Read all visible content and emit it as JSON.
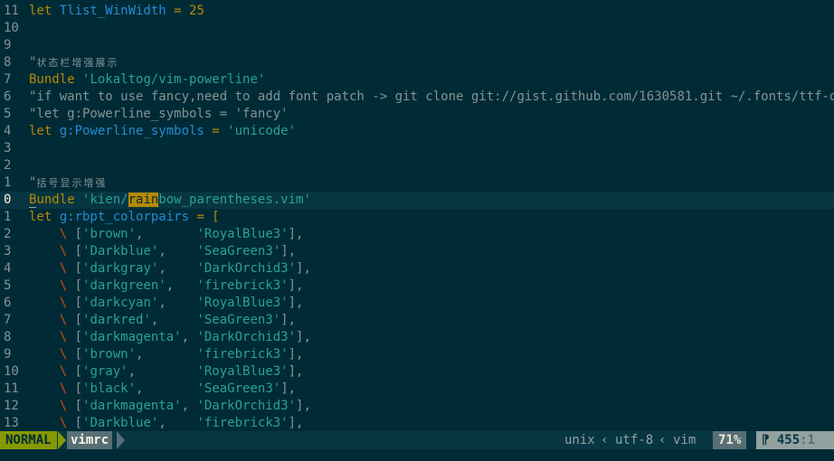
{
  "editor": {
    "lines": [
      {
        "n": "11",
        "segs": [
          {
            "t": "let ",
            "c": "kw"
          },
          {
            "t": "Tlist_WinWidth",
            "c": "var"
          },
          {
            "t": " = ",
            "c": "kw"
          },
          {
            "t": "25",
            "c": "kw"
          }
        ]
      },
      {
        "n": "10",
        "segs": []
      },
      {
        "n": "9",
        "segs": []
      },
      {
        "n": "8",
        "segs": [
          {
            "t": "\"",
            "c": "cmt"
          },
          {
            "t": "状态栏增强展示",
            "c": "cmt small"
          }
        ]
      },
      {
        "n": "7",
        "segs": [
          {
            "t": "Bundle ",
            "c": "kw"
          },
          {
            "t": "'Lokaltog/vim-powerline'",
            "c": "str"
          }
        ]
      },
      {
        "n": "6",
        "segs": [
          {
            "t": "\"if want to use fancy,need to add font patch -> git clone git://gist.github.com/1630581.git ~/.fonts/ttf-dejavu",
            "c": "cmt"
          }
        ]
      },
      {
        "n": "5",
        "segs": [
          {
            "t": "\"let g:Powerline_symbols = 'fancy'",
            "c": "cmt"
          }
        ]
      },
      {
        "n": "4",
        "segs": [
          {
            "t": "let ",
            "c": "kw"
          },
          {
            "t": "g:Powerline_symbols",
            "c": "var"
          },
          {
            "t": " = ",
            "c": "kw"
          },
          {
            "t": "'unicode'",
            "c": "str"
          }
        ]
      },
      {
        "n": "3",
        "segs": []
      },
      {
        "n": "2",
        "segs": []
      },
      {
        "n": "1",
        "segs": [
          {
            "t": "\"",
            "c": "cmt"
          },
          {
            "t": "括号显示增强",
            "c": "cmt small"
          }
        ]
      },
      {
        "n": "0",
        "current": true,
        "segs": [
          {
            "t": "B",
            "c": "kw cursor-underline"
          },
          {
            "t": "undle ",
            "c": "kw"
          },
          {
            "t": "'kien/",
            "c": "str"
          },
          {
            "t": "rain",
            "c": "cursorword"
          },
          {
            "t": "bow_parentheses.vim'",
            "c": "str"
          }
        ]
      },
      {
        "n": "1",
        "segs": [
          {
            "t": "let ",
            "c": "kw"
          },
          {
            "t": "g:rbpt_colorpairs",
            "c": "var"
          },
          {
            "t": " = [",
            "c": "kw"
          }
        ]
      },
      {
        "n": "2",
        "segs": [
          {
            "t": "    \\ ",
            "c": "bs"
          },
          {
            "t": "[",
            "c": ""
          },
          {
            "t": "'brown'",
            "c": "str"
          },
          {
            "t": ",       ",
            "c": ""
          },
          {
            "t": "'RoyalBlue3'",
            "c": "str"
          },
          {
            "t": "],",
            "c": ""
          }
        ]
      },
      {
        "n": "3",
        "segs": [
          {
            "t": "    \\ ",
            "c": "bs"
          },
          {
            "t": "[",
            "c": ""
          },
          {
            "t": "'Darkblue'",
            "c": "str"
          },
          {
            "t": ",    ",
            "c": ""
          },
          {
            "t": "'SeaGreen3'",
            "c": "str"
          },
          {
            "t": "],",
            "c": ""
          }
        ]
      },
      {
        "n": "4",
        "segs": [
          {
            "t": "    \\ ",
            "c": "bs"
          },
          {
            "t": "[",
            "c": ""
          },
          {
            "t": "'darkgray'",
            "c": "str"
          },
          {
            "t": ",    ",
            "c": ""
          },
          {
            "t": "'DarkOrchid3'",
            "c": "str"
          },
          {
            "t": "],",
            "c": ""
          }
        ]
      },
      {
        "n": "5",
        "segs": [
          {
            "t": "    \\ ",
            "c": "bs"
          },
          {
            "t": "[",
            "c": ""
          },
          {
            "t": "'darkgreen'",
            "c": "str"
          },
          {
            "t": ",   ",
            "c": ""
          },
          {
            "t": "'firebrick3'",
            "c": "str"
          },
          {
            "t": "],",
            "c": ""
          }
        ]
      },
      {
        "n": "6",
        "segs": [
          {
            "t": "    \\ ",
            "c": "bs"
          },
          {
            "t": "[",
            "c": ""
          },
          {
            "t": "'darkcyan'",
            "c": "str"
          },
          {
            "t": ",    ",
            "c": ""
          },
          {
            "t": "'RoyalBlue3'",
            "c": "str"
          },
          {
            "t": "],",
            "c": ""
          }
        ]
      },
      {
        "n": "7",
        "segs": [
          {
            "t": "    \\ ",
            "c": "bs"
          },
          {
            "t": "[",
            "c": ""
          },
          {
            "t": "'darkred'",
            "c": "str"
          },
          {
            "t": ",     ",
            "c": ""
          },
          {
            "t": "'SeaGreen3'",
            "c": "str"
          },
          {
            "t": "],",
            "c": ""
          }
        ]
      },
      {
        "n": "8",
        "segs": [
          {
            "t": "    \\ ",
            "c": "bs"
          },
          {
            "t": "[",
            "c": ""
          },
          {
            "t": "'darkmagenta'",
            "c": "str"
          },
          {
            "t": ", ",
            "c": ""
          },
          {
            "t": "'DarkOrchid3'",
            "c": "str"
          },
          {
            "t": "],",
            "c": ""
          }
        ]
      },
      {
        "n": "9",
        "segs": [
          {
            "t": "    \\ ",
            "c": "bs"
          },
          {
            "t": "[",
            "c": ""
          },
          {
            "t": "'brown'",
            "c": "str"
          },
          {
            "t": ",       ",
            "c": ""
          },
          {
            "t": "'firebrick3'",
            "c": "str"
          },
          {
            "t": "],",
            "c": ""
          }
        ]
      },
      {
        "n": "10",
        "segs": [
          {
            "t": "    \\ ",
            "c": "bs"
          },
          {
            "t": "[",
            "c": ""
          },
          {
            "t": "'gray'",
            "c": "str"
          },
          {
            "t": ",        ",
            "c": ""
          },
          {
            "t": "'RoyalBlue3'",
            "c": "str"
          },
          {
            "t": "],",
            "c": ""
          }
        ]
      },
      {
        "n": "11",
        "segs": [
          {
            "t": "    \\ ",
            "c": "bs"
          },
          {
            "t": "[",
            "c": ""
          },
          {
            "t": "'black'",
            "c": "str"
          },
          {
            "t": ",       ",
            "c": ""
          },
          {
            "t": "'SeaGreen3'",
            "c": "str"
          },
          {
            "t": "],",
            "c": ""
          }
        ]
      },
      {
        "n": "12",
        "segs": [
          {
            "t": "    \\ ",
            "c": "bs"
          },
          {
            "t": "[",
            "c": ""
          },
          {
            "t": "'darkmagenta'",
            "c": "str"
          },
          {
            "t": ", ",
            "c": ""
          },
          {
            "t": "'DarkOrchid3'",
            "c": "str"
          },
          {
            "t": "],",
            "c": ""
          }
        ]
      },
      {
        "n": "13",
        "segs": [
          {
            "t": "    \\ ",
            "c": "bs"
          },
          {
            "t": "[",
            "c": ""
          },
          {
            "t": "'Darkblue'",
            "c": "str"
          },
          {
            "t": ",    ",
            "c": ""
          },
          {
            "t": "'firebrick3'",
            "c": "str"
          },
          {
            "t": "],",
            "c": ""
          }
        ]
      }
    ]
  },
  "statusline": {
    "mode": "NORMAL",
    "filename": "vimrc",
    "fileformat": "unix",
    "encoding": "utf-8",
    "filetype": "vim",
    "separator": "‹",
    "percent": "71%",
    "line_icon": "⁋",
    "line": "455",
    "col": ":1"
  },
  "colors": {
    "background": "#002b36",
    "keyword": "#b58900",
    "identifier": "#268bd2",
    "string": "#2aa198",
    "comment": "#839496",
    "backslash": "#cb4b16",
    "mode_bg": "#859900"
  }
}
